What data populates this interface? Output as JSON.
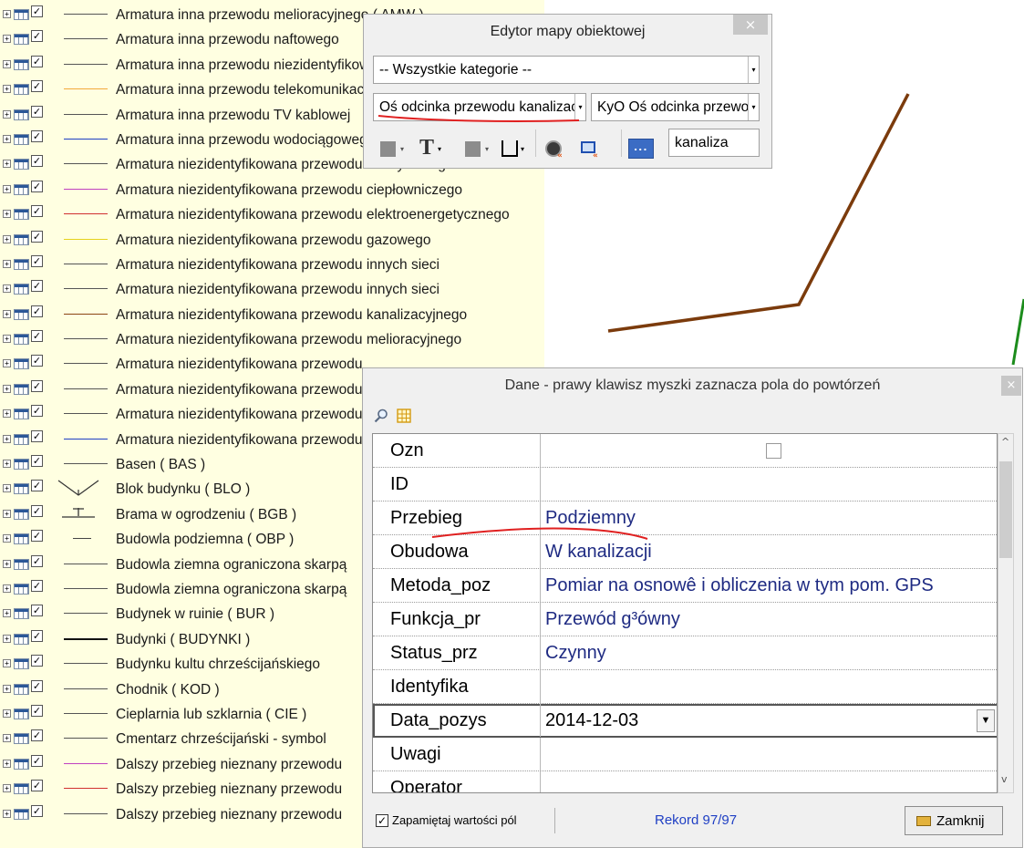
{
  "legend": {
    "items": [
      {
        "label": "Armatura inna przewodu melioracyjnego ( AMW )",
        "line": "#555555"
      },
      {
        "label": "Armatura inna przewodu naftowego",
        "line": "#555555"
      },
      {
        "label": "Armatura inna przewodu niezidentyfikowanego",
        "line": "#555555"
      },
      {
        "label": "Armatura inna przewodu telekomunikacyjnego",
        "line": "#f2a93b"
      },
      {
        "label": "Armatura inna przewodu TV kablowej",
        "line": "#555555"
      },
      {
        "label": "Armatura inna przewodu wodociągowego",
        "line": "#1f3fc4"
      },
      {
        "label": "Armatura niezidentyfikowana przewodu benzynowego",
        "line": "#555555"
      },
      {
        "label": "Armatura niezidentyfikowana przewodu ciepłowniczego",
        "line": "#c040c0"
      },
      {
        "label": "Armatura niezidentyfikowana przewodu elektroenergetycznego",
        "line": "#d03030"
      },
      {
        "label": "Armatura niezidentyfikowana przewodu gazowego",
        "line": "#e6d21c"
      },
      {
        "label": "Armatura niezidentyfikowana przewodu innych sieci",
        "line": "#555555"
      },
      {
        "label": "Armatura niezidentyfikowana przewodu innych sieci",
        "line": "#555555"
      },
      {
        "label": "Armatura niezidentyfikowana przewodu kanalizacyjnego",
        "line": "#8b4513"
      },
      {
        "label": "Armatura niezidentyfikowana przewodu melioracyjnego",
        "line": "#555555"
      },
      {
        "label": "Armatura niezidentyfikowana przewodu",
        "line": "#555555"
      },
      {
        "label": "Armatura niezidentyfikowana przewodu",
        "line": "#555555"
      },
      {
        "label": "Armatura niezidentyfikowana przewodu",
        "line": "#555555"
      },
      {
        "label": "Armatura niezidentyfikowana przewodu",
        "line": "#1f3fc4"
      },
      {
        "label": "Basen ( BAS )",
        "line": "#555555"
      },
      {
        "label": "Blok budynku ( BLO )",
        "line": "blok"
      },
      {
        "label": "Brama w ogrodzeniu ( BGB )",
        "line": "brama"
      },
      {
        "label": "Budowla podziemna ( OBP )",
        "line": "short"
      },
      {
        "label": "Budowla ziemna ograniczona skarpą",
        "line": "#555555"
      },
      {
        "label": "Budowla ziemna ograniczona skarpą",
        "line": "#555555"
      },
      {
        "label": "Budynek w ruinie ( BUR )",
        "line": "#555555"
      },
      {
        "label": "Budynki ( BUDYNKI )",
        "line": "bold"
      },
      {
        "label": "Budynku kultu chrześcijańskiego",
        "line": "#555555"
      },
      {
        "label": "Chodnik ( KOD )",
        "line": "#555555"
      },
      {
        "label": "Cieplarnia lub szklarnia ( CIE )",
        "line": "#555555"
      },
      {
        "label": "Cmentarz chrześcijański - symbol",
        "line": "#555555"
      },
      {
        "label": "Dalszy przebieg nieznany przewodu",
        "line": "#c040c0"
      },
      {
        "label": "Dalszy przebieg nieznany przewodu",
        "line": "#d03030"
      },
      {
        "label": "Dalszy przebieg nieznany przewodu",
        "line": "#555555"
      }
    ]
  },
  "map": {
    "line_color": "#7b3b0c",
    "accent_color": "#1c8c1c"
  },
  "editor": {
    "title": "Edytor mapy obiektowej",
    "close": "×",
    "category_value": "-- Wszystkie kategorie --",
    "object_value": "Oś odcinka przewodu kanalizacyjnego",
    "style_value": "KyO Oś odcinka przewodu",
    "filter_value": "kanaliza",
    "more_label": "..."
  },
  "dane": {
    "title": "Dane - prawy klawisz myszki zaznacza pola do powtórzeń",
    "close": "×",
    "fields": [
      {
        "key": "Ozn",
        "value": ""
      },
      {
        "key": "ID",
        "value": ""
      },
      {
        "key": "Przebieg",
        "value": "Podziemny"
      },
      {
        "key": "Obudowa",
        "value": "W kanalizacji"
      },
      {
        "key": "Metoda_poz",
        "value": "Pomiar na osnowê i obliczenia w tym pom. GPS"
      },
      {
        "key": "Funkcja_pr",
        "value": "Przewód g³ówny"
      },
      {
        "key": "Status_prz",
        "value": "Czynny"
      },
      {
        "key": "Identyfika",
        "value": ""
      },
      {
        "key": "Data_pozys",
        "value": "2014-12-03"
      },
      {
        "key": "Uwagi",
        "value": ""
      },
      {
        "key": "Operator",
        "value": ""
      }
    ],
    "remember_label": "Zapamiętaj wartości pól",
    "record_label": "Rekord 97/97",
    "close_button": "Zamknij"
  }
}
